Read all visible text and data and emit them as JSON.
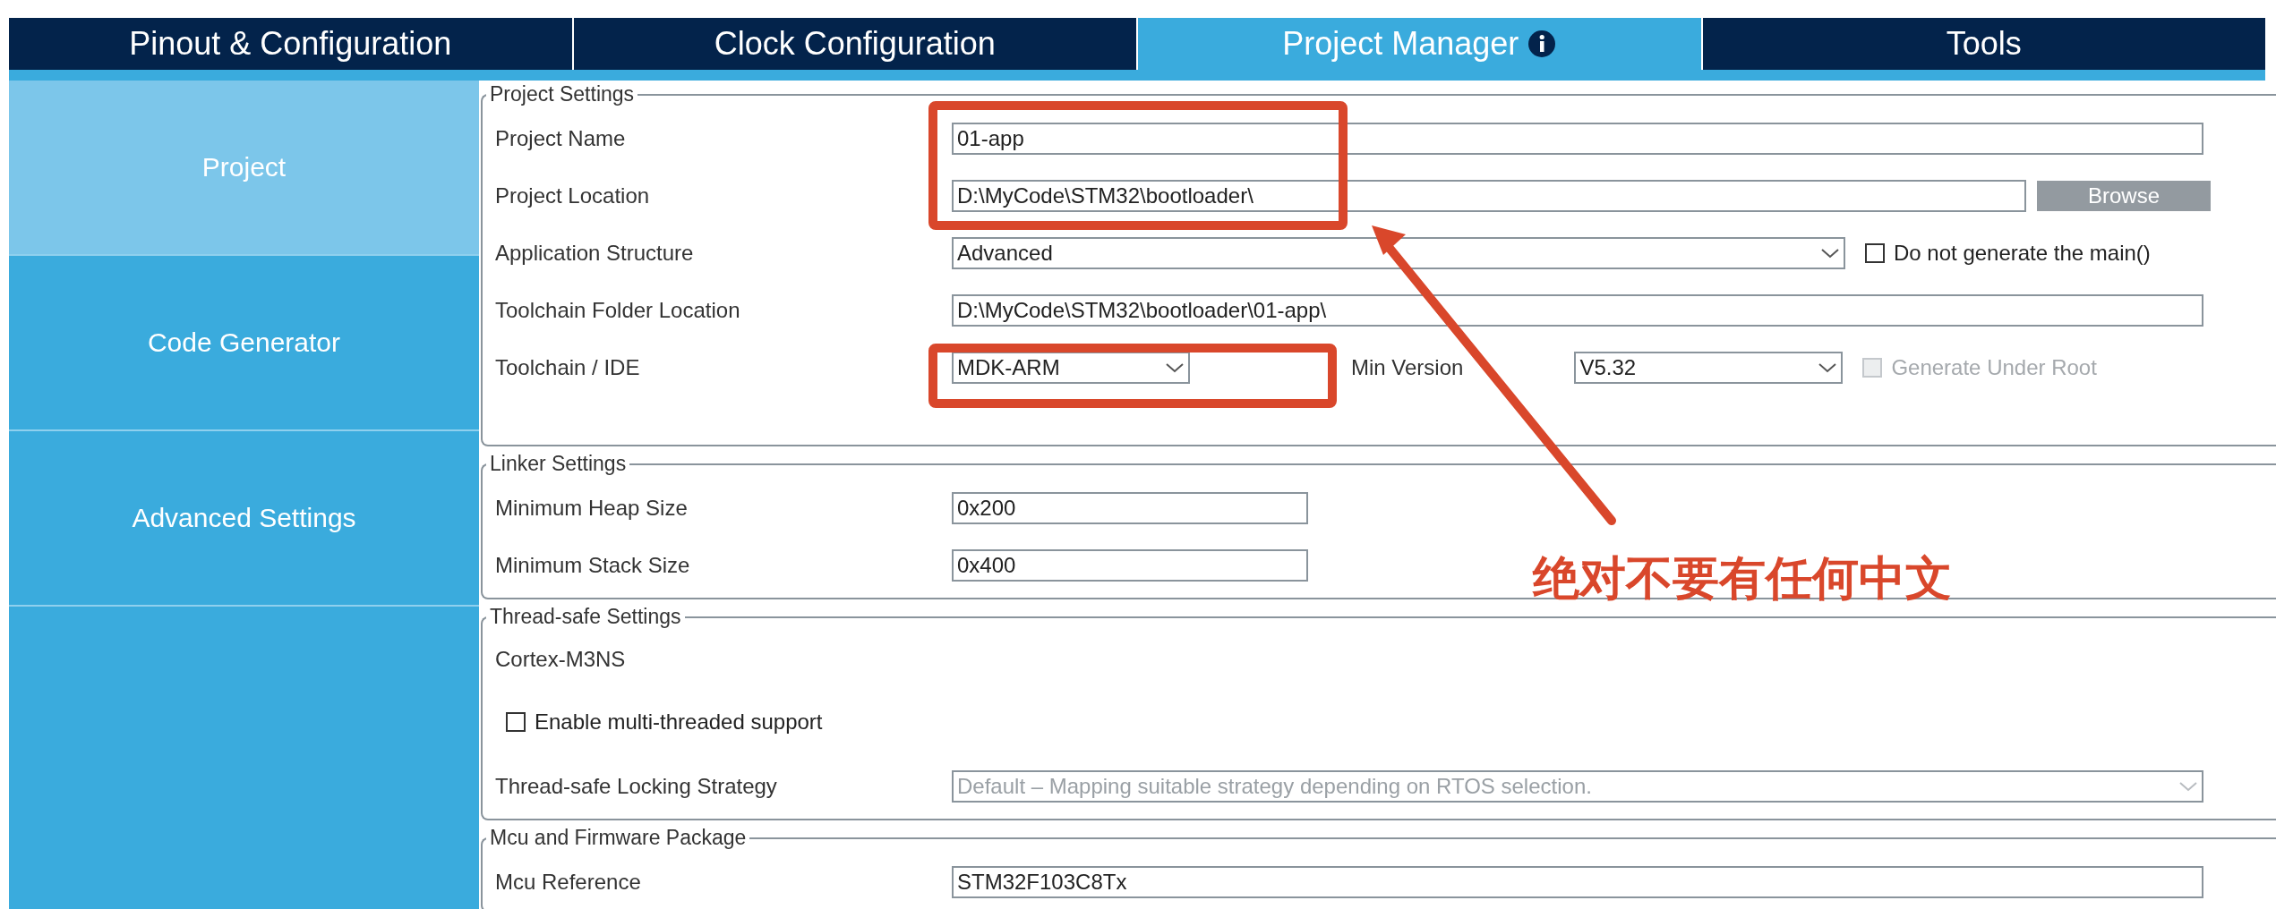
{
  "tabs": [
    {
      "label": "Pinout & Configuration",
      "selected": false,
      "info": false
    },
    {
      "label": "Clock Configuration",
      "selected": false,
      "info": false
    },
    {
      "label": "Project Manager",
      "selected": true,
      "info": true
    },
    {
      "label": "Tools",
      "selected": false,
      "info": false
    }
  ],
  "sidebar": {
    "items": [
      {
        "label": "Project",
        "selected": true
      },
      {
        "label": "Code Generator",
        "selected": false
      },
      {
        "label": "Advanced Settings",
        "selected": false
      }
    ]
  },
  "sections": [
    {
      "title": "Project Settings",
      "rows": [
        {
          "kind": "field",
          "label": "Project Name",
          "value": "01-app"
        },
        {
          "kind": "field_button",
          "label": "Project Location",
          "value": "D:\\MyCode\\STM32\\bootloader\\",
          "button": "Browse"
        },
        {
          "kind": "select_check",
          "label": "Application Structure",
          "value": "Advanced",
          "checkbox": {
            "label": "Do not generate the main()",
            "checked": false,
            "disabled": false
          }
        },
        {
          "kind": "field",
          "label": "Toolchain Folder Location",
          "value": "D:\\MyCode\\STM32\\bootloader\\01-app\\"
        },
        {
          "kind": "select_pair",
          "label": "Toolchain / IDE",
          "value": "MDK-ARM",
          "second_label": "Min Version",
          "second_value": "V5.32",
          "checkbox": {
            "label": "Generate Under Root",
            "checked": false,
            "disabled": true
          }
        }
      ]
    },
    {
      "title": "Linker Settings",
      "rows": [
        {
          "kind": "short_field",
          "label": "Minimum Heap Size",
          "value": "0x200"
        },
        {
          "kind": "short_field",
          "label": "Minimum Stack Size",
          "value": "0x400"
        }
      ]
    },
    {
      "title": "Thread-safe Settings",
      "rows": [
        {
          "kind": "text",
          "label": "Cortex-M3NS"
        },
        {
          "kind": "check",
          "checkbox": {
            "label": "Enable multi-threaded support",
            "checked": false,
            "disabled": false
          }
        },
        {
          "kind": "select",
          "label": "Thread-safe Locking Strategy",
          "value": "Default – Mapping suitable strategy depending on RTOS selection.",
          "disabled": true
        }
      ]
    },
    {
      "title": "Mcu and Firmware Package",
      "rows": [
        {
          "kind": "field",
          "label": "Mcu Reference",
          "value": "STM32F103C8Tx"
        }
      ]
    }
  ],
  "annotation": {
    "note": "绝对不要有任何中文"
  }
}
